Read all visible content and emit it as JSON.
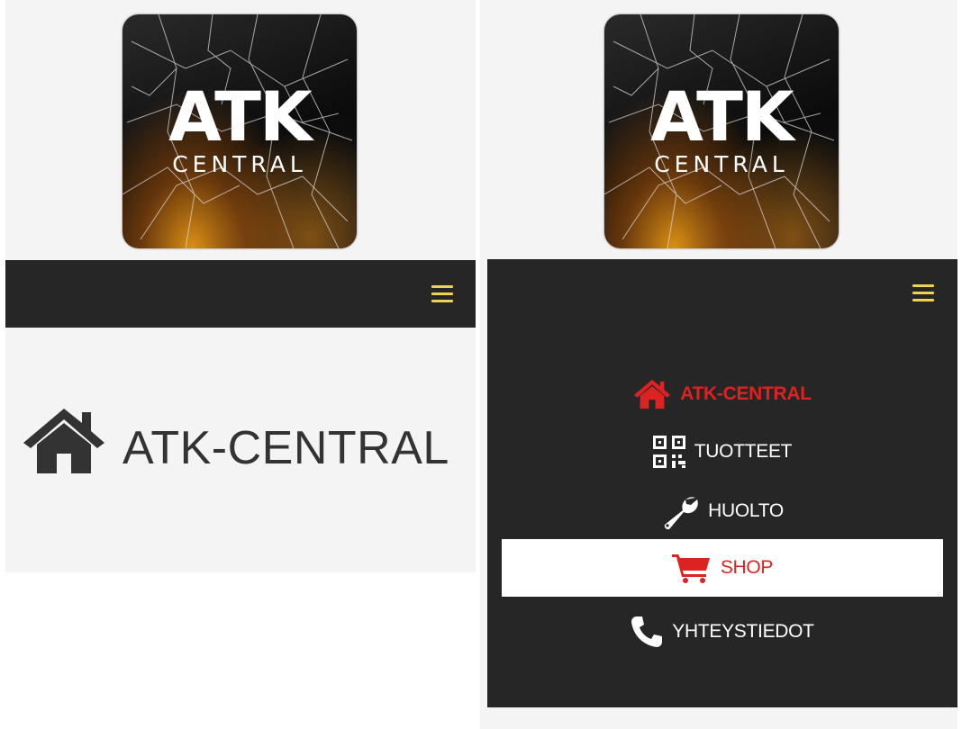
{
  "logo": {
    "title": "ATK",
    "subtitle": "CENTRAL"
  },
  "collapsed_view": {
    "hero_title": "ATK-CENTRAL"
  },
  "menu": {
    "items": [
      {
        "label": "ATK-CENTRAL",
        "icon": "home-icon",
        "state": "active"
      },
      {
        "label": "TUOTTEET",
        "icon": "qr-code-icon"
      },
      {
        "label": "HUOLTO",
        "icon": "wrench-icon"
      },
      {
        "label": "SHOP",
        "icon": "shopping-cart-icon",
        "state": "hover"
      },
      {
        "label": "YHTEYSTIEDOT",
        "icon": "phone-icon"
      }
    ]
  },
  "colors": {
    "navbar_bg": "#262626",
    "hamburger": "#f0d253",
    "active_red": "#dd2222",
    "page_bg": "#f4f4f4"
  }
}
